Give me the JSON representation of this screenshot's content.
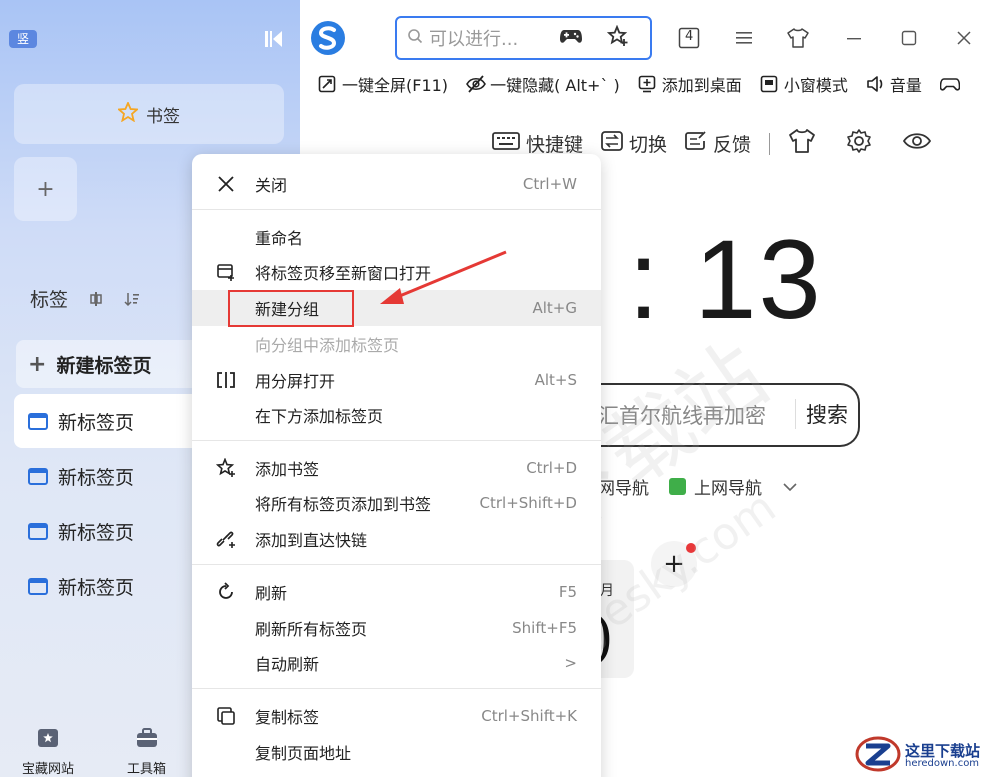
{
  "sidebar": {
    "vertical_badge": "竖",
    "bookmark_card_label": "书签",
    "add_card_label": "+",
    "tabs_title": "标签",
    "new_tab_label": "新建标签页",
    "tabs": [
      {
        "label": "新标签页"
      },
      {
        "label": "新标签页"
      },
      {
        "label": "新标签页"
      },
      {
        "label": "新标签页"
      }
    ],
    "bottom_links": [
      {
        "label": "宝藏网站",
        "icon": "star-folder-icon"
      },
      {
        "label": "工具箱",
        "icon": "toolbox-icon"
      }
    ]
  },
  "topbar": {
    "search_placeholder": "可以进行...",
    "tab_count": "4"
  },
  "toolbar2": {
    "items": [
      {
        "label": "一键全屏(F11)",
        "icon": "fullscreen-icon"
      },
      {
        "label": "一键隐藏( Alt+` )",
        "icon": "hide-icon"
      },
      {
        "label": "添加到桌面",
        "icon": "add-desktop-icon"
      },
      {
        "label": "小窗模式",
        "icon": "mini-window-icon"
      },
      {
        "label": "音量",
        "icon": "volume-icon"
      }
    ]
  },
  "content": {
    "tools": {
      "shortcut": "快捷键",
      "switch": "切换",
      "feedback": "反馈"
    },
    "time": ": 13",
    "search_placeholder": "汇首尔航线再加密",
    "search_button": "搜索",
    "nav_left": "网导航",
    "nav_right": "上网导航",
    "calendar_month": "月",
    "calendar_digit": ")"
  },
  "context_menu": {
    "items": [
      {
        "label": "关闭",
        "shortcut": "Ctrl+W"
      },
      {
        "label": "重命名",
        "shortcut": ""
      },
      {
        "label": "将标签页移至新窗口打开",
        "shortcut": ""
      },
      {
        "label": "新建分组",
        "shortcut": "Alt+G"
      },
      {
        "label": "向分组中添加标签页",
        "shortcut": ""
      },
      {
        "label": "用分屏打开",
        "shortcut": "Alt+S"
      },
      {
        "label": "在下方添加标签页",
        "shortcut": ""
      },
      {
        "label": "添加书签",
        "shortcut": "Ctrl+D"
      },
      {
        "label": "将所有标签页添加到书签",
        "shortcut": "Ctrl+Shift+D"
      },
      {
        "label": "添加到直达快链",
        "shortcut": ""
      },
      {
        "label": "刷新",
        "shortcut": "F5"
      },
      {
        "label": "刷新所有标签页",
        "shortcut": "Shift+F5"
      },
      {
        "label": "自动刷新",
        "shortcut": ">"
      },
      {
        "label": "复制标签",
        "shortcut": "Ctrl+Shift+K"
      },
      {
        "label": "复制页面地址",
        "shortcut": ""
      }
    ]
  },
  "watermark": {
    "main": "天极下载站",
    "url": "mydown.yesky.com"
  },
  "site_mark": {
    "name": "这里下载站",
    "url": "heredown.com"
  },
  "colors": {
    "accent": "#3a7bf0",
    "tab_icon": "#2a6fdb",
    "highlight": "#e53935",
    "green": "#3fae49"
  }
}
